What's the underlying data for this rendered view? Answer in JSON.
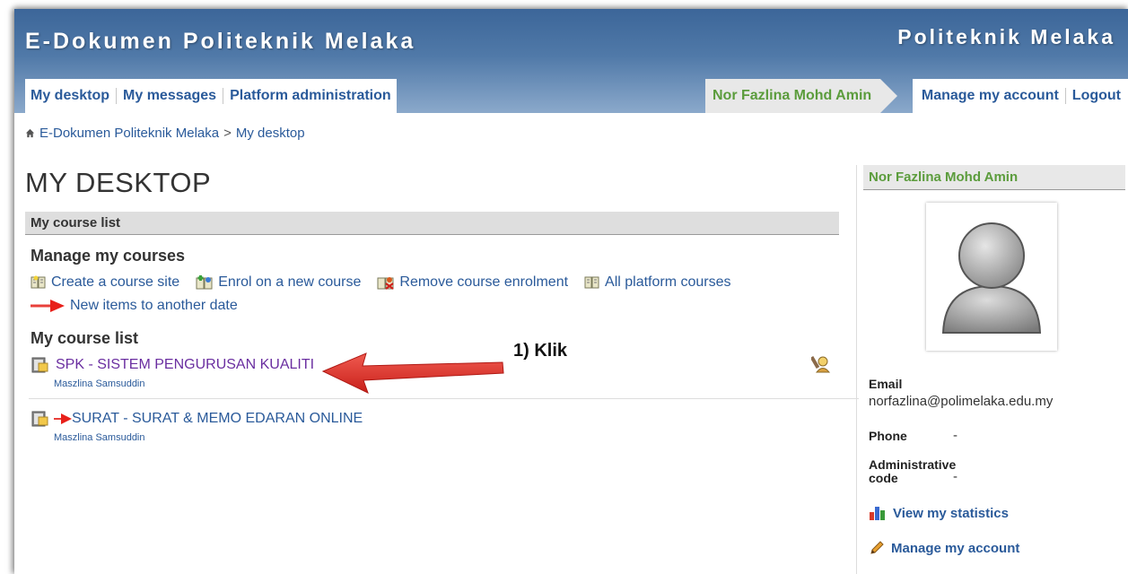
{
  "header": {
    "site_title": "E-Dokumen Politeknik Melaka",
    "institution": "Politeknik Melaka"
  },
  "nav": {
    "left": [
      "My desktop",
      "My messages",
      "Platform administration"
    ],
    "user_name": "Nor Fazlina Mohd Amin",
    "right": [
      "Manage my account",
      "Logout"
    ]
  },
  "breadcrumb": {
    "home": "E-Dokumen Politeknik Melaka",
    "sep": ">",
    "current": "My desktop"
  },
  "main": {
    "page_title": "MY DESKTOP",
    "section_title": "My course list",
    "manage_heading": "Manage my courses",
    "actions": [
      {
        "label": "Create a course site",
        "icon": "create-course-icon"
      },
      {
        "label": "Enrol on a new course",
        "icon": "enrol-course-icon"
      },
      {
        "label": "Remove course enrolment",
        "icon": "remove-enrolment-icon"
      },
      {
        "label": "All platform courses",
        "icon": "all-courses-icon"
      }
    ],
    "new_items_label": "New items to another date",
    "list_heading": "My course list",
    "courses": [
      {
        "title": "SPK - SISTEM PENGURUSAN KUALITI",
        "teacher": "Maszlina Samsuddin",
        "visited": true
      },
      {
        "title": "SURAT - SURAT & MEMO EDARAN ONLINE",
        "teacher": "Maszlina Samsuddin",
        "visited": false
      }
    ],
    "annotation": "1) Klik"
  },
  "sidebar": {
    "user_name": "Nor Fazlina Mohd Amin",
    "email_label": "Email",
    "email": "norfazlina@polimelaka.edu.my",
    "phone_label": "Phone",
    "phone": "-",
    "admin_code_label_1": "Administrative",
    "admin_code_label_2": "code",
    "admin_code": "-",
    "stats_link": "View my statistics",
    "account_link": "Manage my account"
  },
  "colors": {
    "header_top": "#3c6699",
    "link": "#2a5a9a",
    "user_green": "#5b9c3c",
    "annotation_red": "#e8403a"
  }
}
